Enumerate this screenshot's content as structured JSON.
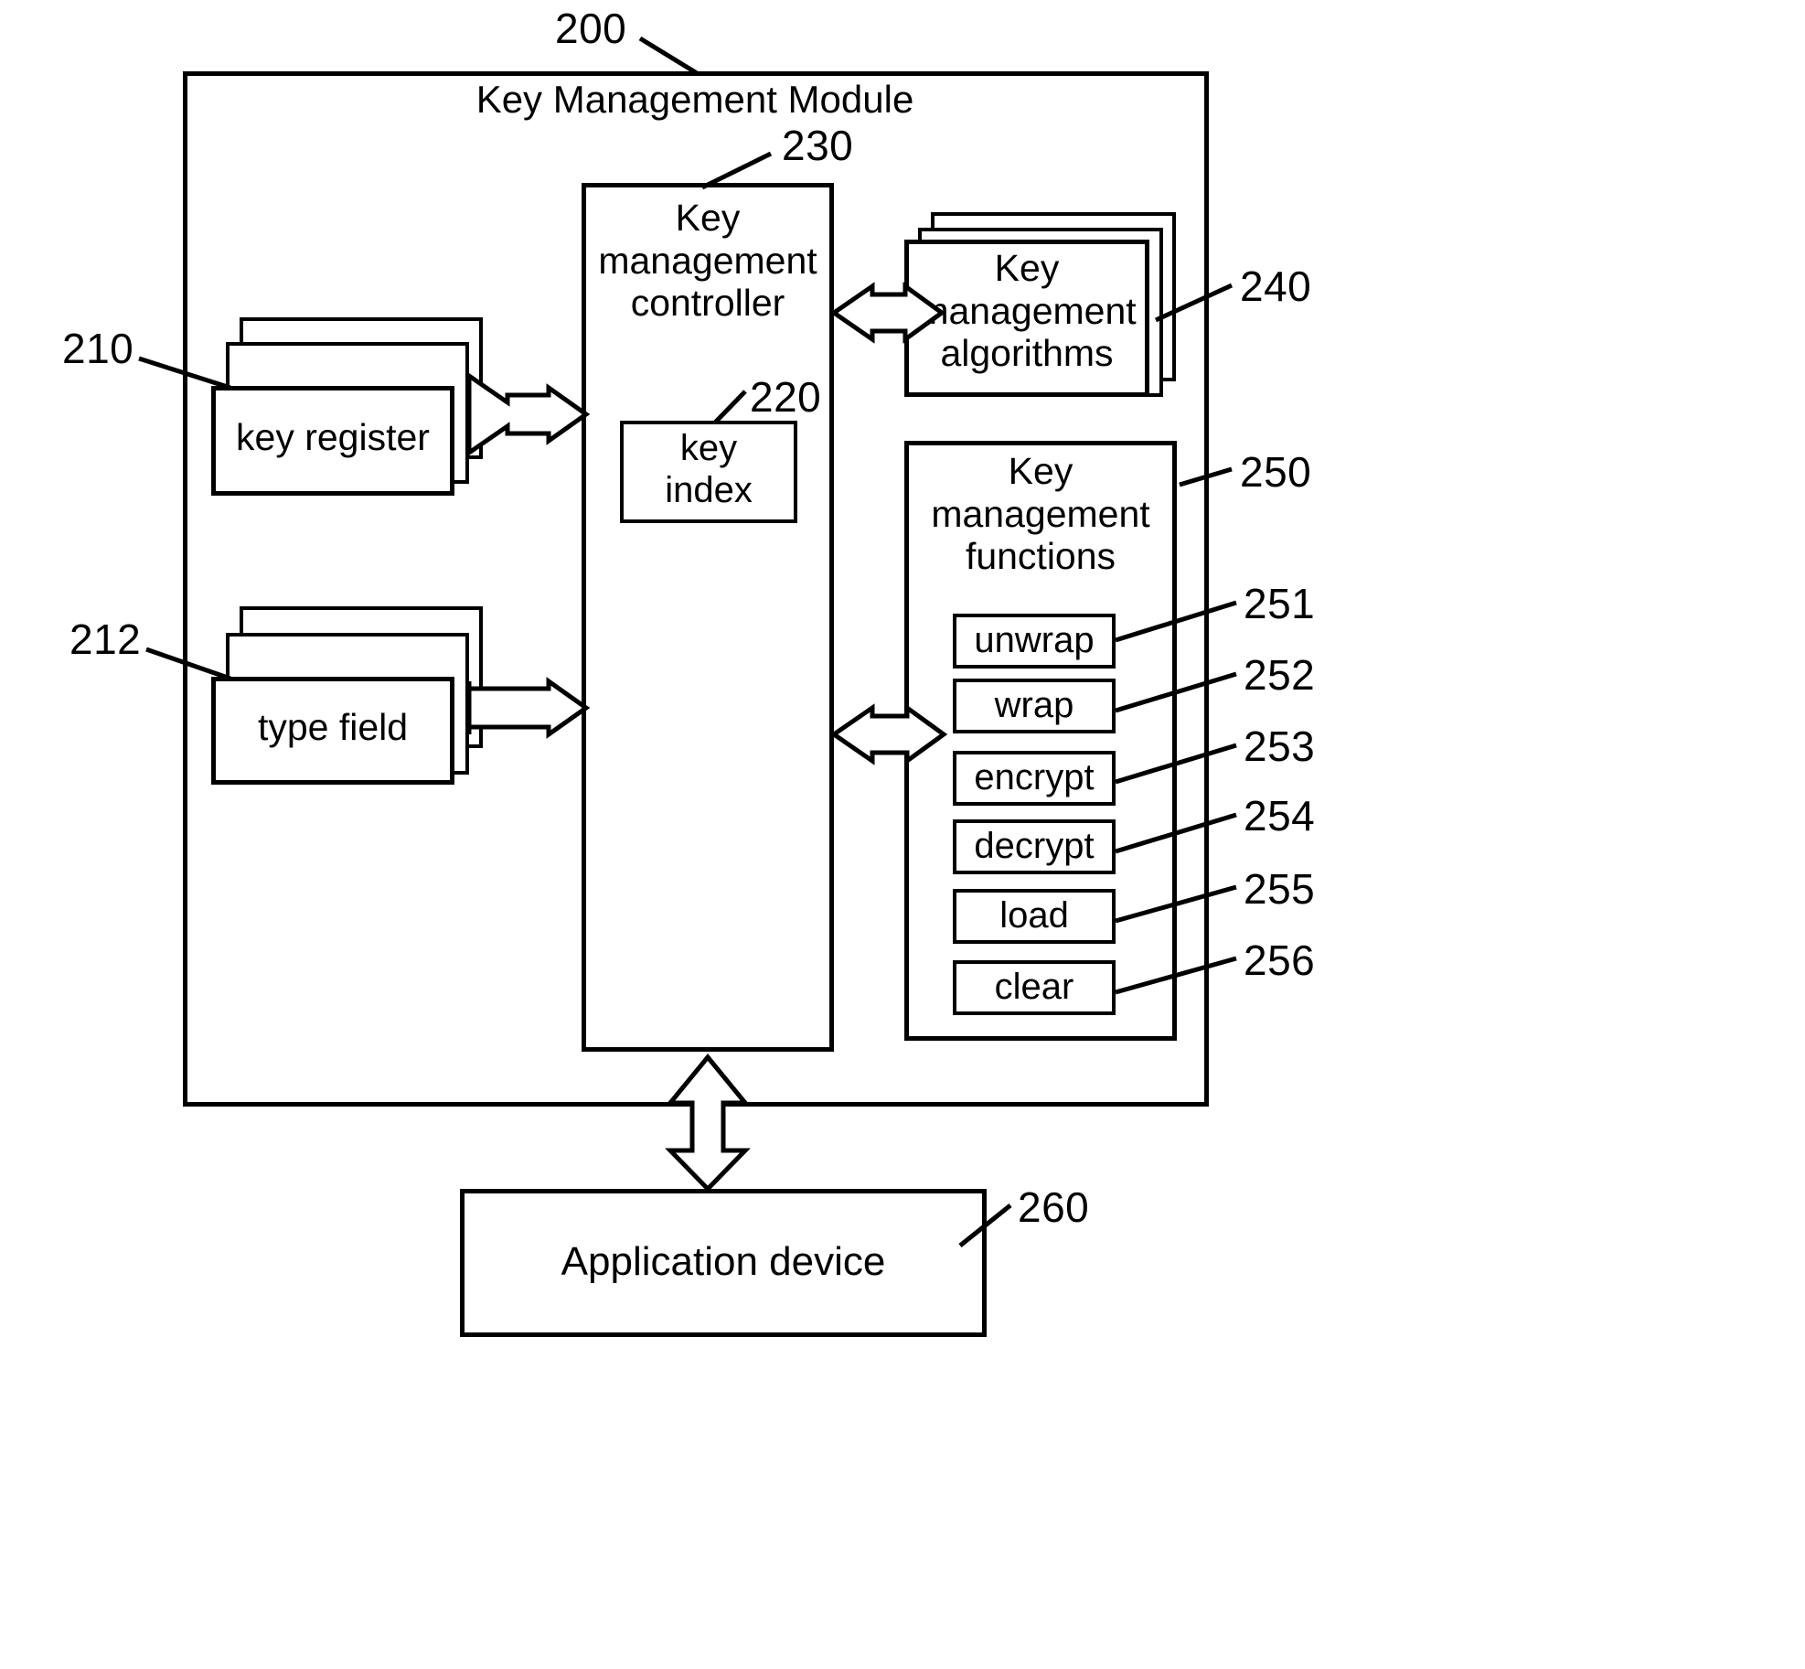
{
  "figure": {
    "module": {
      "title": "Key Management Module",
      "ref": "200"
    },
    "controller": {
      "title": "Key\nmanagement\ncontroller",
      "ref": "230"
    },
    "key_index": {
      "title": "key\nindex",
      "ref": "220"
    },
    "key_register": {
      "title": "key register",
      "ref": "210",
      "stack_count": 3
    },
    "type_field": {
      "title": "type field",
      "ref": "212",
      "stack_count": 3
    },
    "algorithms": {
      "title": "Key\nmanagement\nalgorithms",
      "ref": "240",
      "stack_count": 3
    },
    "functions": {
      "title": "Key\nmanagement\nfunctions",
      "ref": "250",
      "items": [
        {
          "label": "unwrap",
          "ref": "251"
        },
        {
          "label": "wrap",
          "ref": "252"
        },
        {
          "label": "encrypt",
          "ref": "253"
        },
        {
          "label": "decrypt",
          "ref": "254"
        },
        {
          "label": "load",
          "ref": "255"
        },
        {
          "label": "clear",
          "ref": "256"
        }
      ]
    },
    "application_device": {
      "title": "Application device",
      "ref": "260"
    },
    "connections": [
      {
        "name": "key-register-to-controller",
        "style": "double-headed-block-arrow"
      },
      {
        "name": "type-field-to-controller",
        "style": "single-headed-block-arrow"
      },
      {
        "name": "controller-to-algorithms",
        "style": "double-headed-block-arrow"
      },
      {
        "name": "controller-to-functions",
        "style": "double-headed-block-arrow"
      },
      {
        "name": "module-to-application-device",
        "style": "double-headed-block-arrow-vertical"
      }
    ],
    "colors": {
      "stroke": "#000000",
      "fill": "#ffffff"
    }
  }
}
